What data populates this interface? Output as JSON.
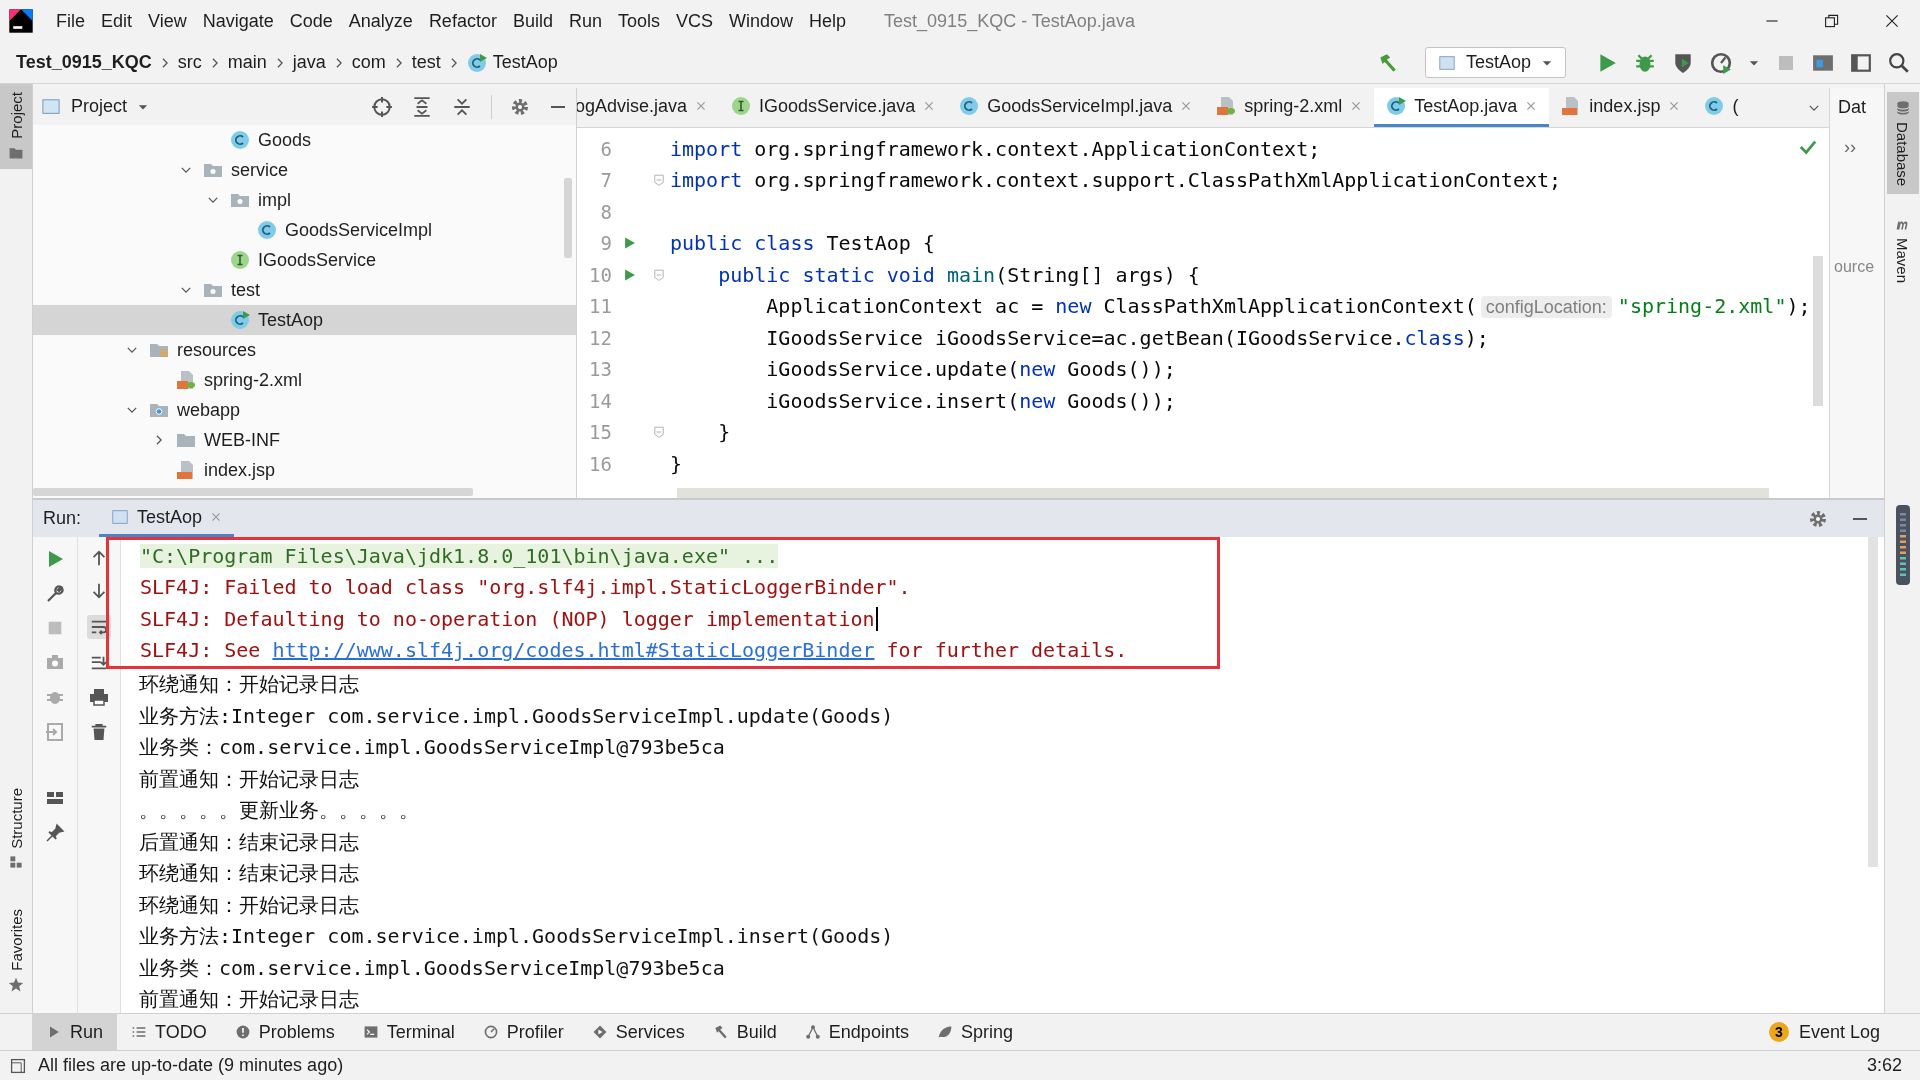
{
  "menu": [
    {
      "label": "File"
    },
    {
      "label": "Edit"
    },
    {
      "label": "View"
    },
    {
      "label": "Navigate"
    },
    {
      "label": "Code"
    },
    {
      "label": "Analyze"
    },
    {
      "label": "Refactor"
    },
    {
      "label": "Build"
    },
    {
      "label": "Run"
    },
    {
      "label": "Tools"
    },
    {
      "label": "VCS"
    },
    {
      "label": "Window"
    },
    {
      "label": "Help"
    }
  ],
  "window": {
    "title": "Test_0915_KQC - TestAop.java"
  },
  "breadcrumbs": [
    {
      "label": "Test_0915_KQC",
      "kind": "project"
    },
    {
      "label": "src",
      "kind": "folder"
    },
    {
      "label": "main",
      "kind": "folder"
    },
    {
      "label": "java",
      "kind": "folder"
    },
    {
      "label": "com",
      "kind": "folder"
    },
    {
      "label": "test",
      "kind": "folder"
    },
    {
      "label": "TestAop",
      "kind": "class"
    }
  ],
  "run_config": {
    "label": "TestAop"
  },
  "left_stripe": [
    {
      "label": "Project",
      "kind": "project",
      "selected": true
    },
    {
      "label": "Structure",
      "kind": "structure",
      "selected": false
    },
    {
      "label": "Favorites",
      "kind": "favorites",
      "selected": false
    }
  ],
  "right_stripe": [
    {
      "label": "Database",
      "kind": "database",
      "selected": true
    },
    {
      "label": "Maven",
      "kind": "maven",
      "selected": false
    }
  ],
  "project": {
    "title": "Project",
    "tree": [
      {
        "children": [
          {
            "children": [
              {
                "children": [
                  {
                    "label": "Goods",
                    "kind": "class",
                    "selected": false
                  }
                ]
              },
              {
                "label": "service",
                "kind": "package",
                "expanded": true,
                "selected": false,
                "children": [
                  {
                    "label": "impl",
                    "kind": "package",
                    "expanded": true,
                    "selected": false,
                    "children": [
                      {
                        "label": "GoodsServiceImpl",
                        "kind": "class",
                        "selected": false
                      }
                    ]
                  },
                  {
                    "label": "IGoodsService",
                    "kind": "interface",
                    "selected": false
                  }
                ]
              },
              {
                "label": "test",
                "kind": "package",
                "expanded": true,
                "selected": false,
                "children": [
                  {
                    "label": "TestAop",
                    "kind": "runnable",
                    "selected": true
                  }
                ]
              }
            ]
          }
        ]
      },
      {
        "label": "resources",
        "kind": "resources",
        "expanded": true,
        "selected": false,
        "children": [
          {
            "label": "spring-2.xml",
            "kind": "xml",
            "selected": false
          }
        ]
      },
      {
        "label": "webapp",
        "kind": "web",
        "expanded": true,
        "selected": false,
        "children": [
          {
            "label": "WEB-INF",
            "kind": "folder",
            "expanded": false,
            "selected": false
          },
          {
            "label": "index.jsp",
            "kind": "jsp",
            "selected": false
          }
        ]
      }
    ]
  },
  "editor": {
    "tabs": [
      {
        "label": "ogAdvise.java",
        "kind": "cut",
        "selected": false
      },
      {
        "label": "IGoodsService.java",
        "kind": "interface",
        "selected": false
      },
      {
        "label": "GoodsServiceImpl.java",
        "kind": "class",
        "selected": false
      },
      {
        "label": "spring-2.xml",
        "kind": "xml",
        "selected": false
      },
      {
        "label": "TestAop.java",
        "kind": "runnable",
        "selected": true
      },
      {
        "label": "index.jsp",
        "kind": "jsp",
        "selected": false
      },
      {
        "label": "(",
        "kind": "class",
        "selected": false
      }
    ],
    "lines": [
      {
        "number": "6",
        "run": false,
        "fold": false,
        "tokens": [
          {
            "kind": "keyword",
            "text": "import"
          },
          {
            "kind": "plain",
            "text": " org.springframework.context.ApplicationContext;"
          }
        ]
      },
      {
        "number": "7",
        "run": false,
        "fold": true,
        "tokens": [
          {
            "kind": "keyword",
            "text": "import"
          },
          {
            "kind": "plain",
            "text": " org.springframework.context.support.ClassPathXmlApplicationContext;"
          }
        ]
      },
      {
        "number": "8",
        "run": false,
        "fold": false
      },
      {
        "number": "9",
        "run": true,
        "fold": false,
        "tokens": [
          {
            "kind": "keyword",
            "text": "public class"
          },
          {
            "kind": "plain",
            "text": " TestAop {"
          }
        ]
      },
      {
        "number": "10",
        "run": true,
        "fold": true,
        "tokens": [
          {
            "kind": "keyword",
            "text": "    public static void"
          },
          {
            "kind": "method",
            "text": " main"
          },
          {
            "kind": "plain",
            "text": "(String[] args) {"
          }
        ]
      },
      {
        "number": "11",
        "run": false,
        "fold": false,
        "tokens": [
          {
            "kind": "plain",
            "text": "        ApplicationContext ac = "
          },
          {
            "kind": "keyword",
            "text": "new"
          },
          {
            "kind": "plain",
            "text": " ClassPathXmlApplicationContext("
          },
          {
            "kind": "hint",
            "text": "configLocation:"
          },
          {
            "kind": "string",
            "text": "\"spring-2.xml\""
          },
          {
            "kind": "plain",
            "text": ");"
          }
        ]
      },
      {
        "number": "12",
        "run": false,
        "fold": false,
        "tokens": [
          {
            "kind": "plain",
            "text": "        IGoodsService iGoodsService=ac.getBean(IGoodsService."
          },
          {
            "kind": "keyword",
            "text": "class"
          },
          {
            "kind": "plain",
            "text": ");"
          }
        ]
      },
      {
        "number": "13",
        "run": false,
        "fold": false,
        "tokens": [
          {
            "kind": "plain",
            "text": "        iGoodsService.update("
          },
          {
            "kind": "keyword",
            "text": "new"
          },
          {
            "kind": "plain",
            "text": " Goods());"
          }
        ]
      },
      {
        "number": "14",
        "run": false,
        "fold": false,
        "tokens": [
          {
            "kind": "plain",
            "text": "        iGoodsService.insert("
          },
          {
            "kind": "keyword",
            "text": "new"
          },
          {
            "kind": "plain",
            "text": " Goods());"
          }
        ]
      },
      {
        "number": "15",
        "run": false,
        "fold": true,
        "tokens": [
          {
            "kind": "plain",
            "text": "    }"
          }
        ]
      },
      {
        "number": "16",
        "run": false,
        "fold": false,
        "tokens": [
          {
            "kind": "plain",
            "text": "}"
          }
        ]
      }
    ],
    "side": {
      "tab": "Dat",
      "chevron": "››",
      "text": "ource"
    }
  },
  "run": {
    "title": "Run:",
    "tab": {
      "label": "TestAop",
      "selected": true
    },
    "console": [
      {
        "kind": "command",
        "highlighted": true,
        "cursor": false,
        "text": "\"C:\\Program Files\\Java\\jdk1.8.0_101\\bin\\java.exe\" ..."
      },
      {
        "kind": "error",
        "highlighted": true,
        "cursor": false,
        "text": "SLF4J: Failed to load class \"org.slf4j.impl.StaticLoggerBinder\"."
      },
      {
        "kind": "error",
        "highlighted": true,
        "cursor": true,
        "text": "SLF4J: Defaulting to no-operation (NOP) logger implementation"
      },
      {
        "kind": "error",
        "highlighted": true,
        "cursor": false,
        "parts": [
          {
            "kind": "text",
            "text": "SLF4J: See "
          },
          {
            "kind": "link",
            "text": "http://www.slf4j.org/codes.html#StaticLoggerBinder"
          },
          {
            "kind": "text",
            "text": " for further details."
          }
        ]
      },
      {
        "kind": "output",
        "highlighted": false,
        "cursor": false,
        "text": "环绕通知：开始记录日志"
      },
      {
        "kind": "output",
        "highlighted": false,
        "cursor": false,
        "text": "业务方法:Integer com.service.impl.GoodsServiceImpl.update(Goods)"
      },
      {
        "kind": "output",
        "highlighted": false,
        "cursor": false,
        "text": "业务类：com.service.impl.GoodsServiceImpl@793be5ca"
      },
      {
        "kind": "output",
        "highlighted": false,
        "cursor": false,
        "text": "前置通知：开始记录日志"
      },
      {
        "kind": "output",
        "highlighted": false,
        "cursor": false,
        "text": "。。。。。更新业务。。。。。"
      },
      {
        "kind": "output",
        "highlighted": false,
        "cursor": false,
        "text": "后置通知：结束记录日志"
      },
      {
        "kind": "output",
        "highlighted": false,
        "cursor": false,
        "text": "环绕通知：结束记录日志"
      },
      {
        "kind": "output",
        "highlighted": false,
        "cursor": false,
        "text": "环绕通知：开始记录日志"
      },
      {
        "kind": "output",
        "highlighted": false,
        "cursor": false,
        "text": "业务方法:Integer com.service.impl.GoodsServiceImpl.insert(Goods)"
      },
      {
        "kind": "output",
        "highlighted": false,
        "cursor": false,
        "text": "业务类：com.service.impl.GoodsServiceImpl@793be5ca"
      },
      {
        "kind": "output",
        "highlighted": false,
        "cursor": false,
        "text": "前置通知：开始记录日志"
      }
    ]
  },
  "tool_windows": [
    {
      "label": "Run",
      "kind": "run",
      "selected": true
    },
    {
      "label": "TODO",
      "kind": "todo",
      "selected": false
    },
    {
      "label": "Problems",
      "kind": "problems",
      "selected": false
    },
    {
      "label": "Terminal",
      "kind": "terminal",
      "selected": false
    },
    {
      "label": "Profiler",
      "kind": "profiler",
      "selected": false
    },
    {
      "label": "Services",
      "kind": "services",
      "selected": false
    },
    {
      "label": "Build",
      "kind": "build",
      "selected": false
    },
    {
      "label": "Endpoints",
      "kind": "endpoints",
      "selected": false
    },
    {
      "label": "Spring",
      "kind": "spring",
      "selected": false
    }
  ],
  "event_log": {
    "label": "Event Log",
    "count": "3"
  },
  "status_bar": {
    "message": "All files are up-to-date (9 minutes ago)",
    "position": "3:62"
  }
}
